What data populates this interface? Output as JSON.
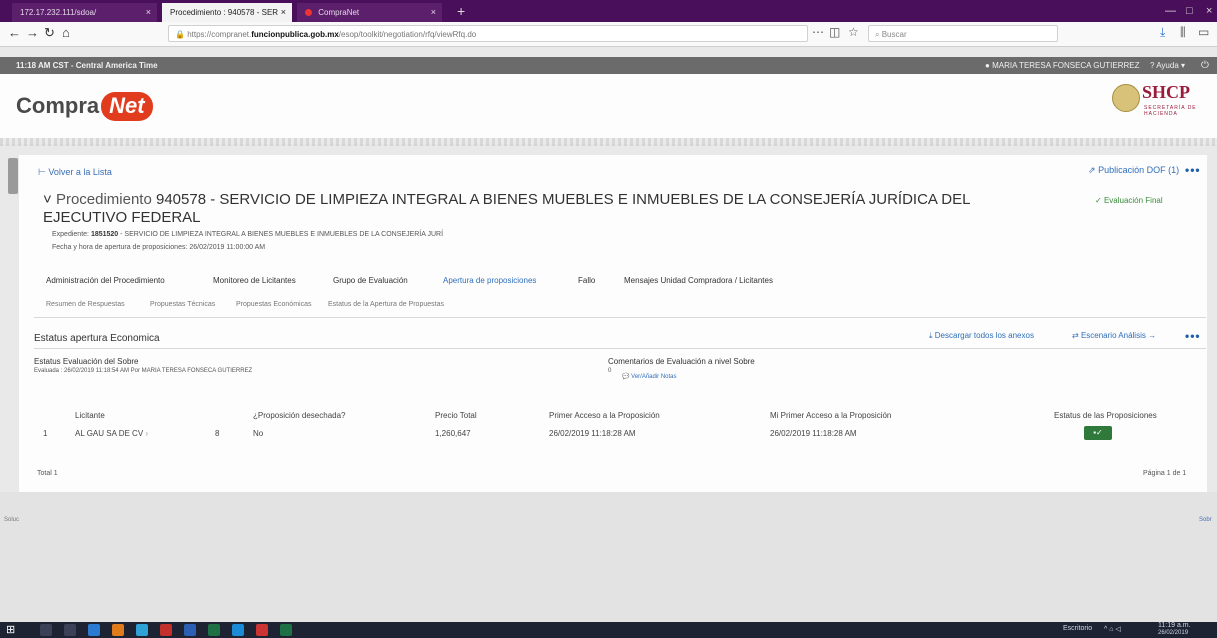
{
  "browser": {
    "tabs": [
      {
        "label": "172.17.232.111/sdoa/"
      },
      {
        "label": "Procedimiento : 940578 - SER"
      },
      {
        "label": "CompraNet"
      }
    ],
    "url_prefix": "https://compranet.",
    "url_domain": "funcionpublica.gob.mx",
    "url_suffix": "/esop/toolkit/negotiation/rfq/viewRfq.do",
    "search_placeholder": "Buscar",
    "new_tab": "+",
    "close_glyph": "×"
  },
  "topbar": {
    "time": "11:18 AM CST - Central America Time",
    "user": "MARIA TERESA FONSECA GUTIERREZ",
    "help": "Ayuda"
  },
  "header": {
    "logo_compra": "Compra",
    "logo_net": "Net",
    "agency": "SHCP",
    "agency_sub": "SECRETARÍA DE HACIENDA"
  },
  "page": {
    "back": "Volver a la Lista",
    "publish": "Publicación DOF (1)",
    "title_label": "Procedimiento",
    "title_text": "940578 - SERVICIO DE LIMPIEZA INTEGRAL A BIENES MUEBLES E INMUEBLES DE LA CONSEJERÍA JURÍDICA DEL EJECUTIVO FEDERAL",
    "status": "Evaluación Final",
    "expediente_label": "Expediente:",
    "expediente_num": "1851520",
    "expediente_desc": " - SERVICIO DE LIMPIEZA INTEGRAL A BIENES MUEBLES E INMUEBLES DE LA CONSEJERÍA JURÍ",
    "apertura": "Fecha y hora de apertura de proposiciones: 26/02/2019 11:00:00 AM"
  },
  "tabs": [
    "Administración del Procedimiento",
    "Monitoreo de Licitantes",
    "Grupo de Evaluación",
    "Apertura de proposiciones",
    "Fallo",
    "Mensajes Unidad Compradora / Licitantes"
  ],
  "subtabs": [
    "Resumen de Respuestas",
    "Propuestas Técnicas",
    "Propuestas Económicas",
    "Estatus de la Apertura de Propuestas"
  ],
  "section": {
    "title": "Estatus apertura Economica",
    "download": "Descargar todos los anexos",
    "scenario": "Escenario Análisis",
    "eval_title": "Estatus Evaluación del Sobre",
    "eval_detail": "Evaluada : 26/02/2019 11:18:54 AM  Por MARIA TERESA FONSECA GUTIERREZ",
    "comments_title": "Comentarios de Evaluación a nivel Sobre",
    "comments_count": "0",
    "comments_link": "Ver/Añadir Notas"
  },
  "table": {
    "headers": [
      "Licitante",
      "¿Proposición desechada?",
      "Precio Total",
      "Primer Acceso a la Proposición",
      "Mi Primer Acceso a la Proposición",
      "Estatus de las Proposiciones"
    ],
    "rows": [
      {
        "num": "1",
        "licitante": "AL GAU SA DE CV",
        "count": "8",
        "desechada": "No",
        "precio": "1,260,647",
        "primer": "26/02/2019 11:18:28 AM",
        "mi_primer": "26/02/2019 11:18:28 AM"
      }
    ]
  },
  "footer": {
    "total": "Total 1",
    "page": "Página 1 de 1"
  },
  "lower": {
    "left": "Soluc",
    "right": "Sobr"
  },
  "taskbar": {
    "lang": "Escritorio",
    "time": "11:19 a.m.",
    "date": "26/02/2019"
  }
}
